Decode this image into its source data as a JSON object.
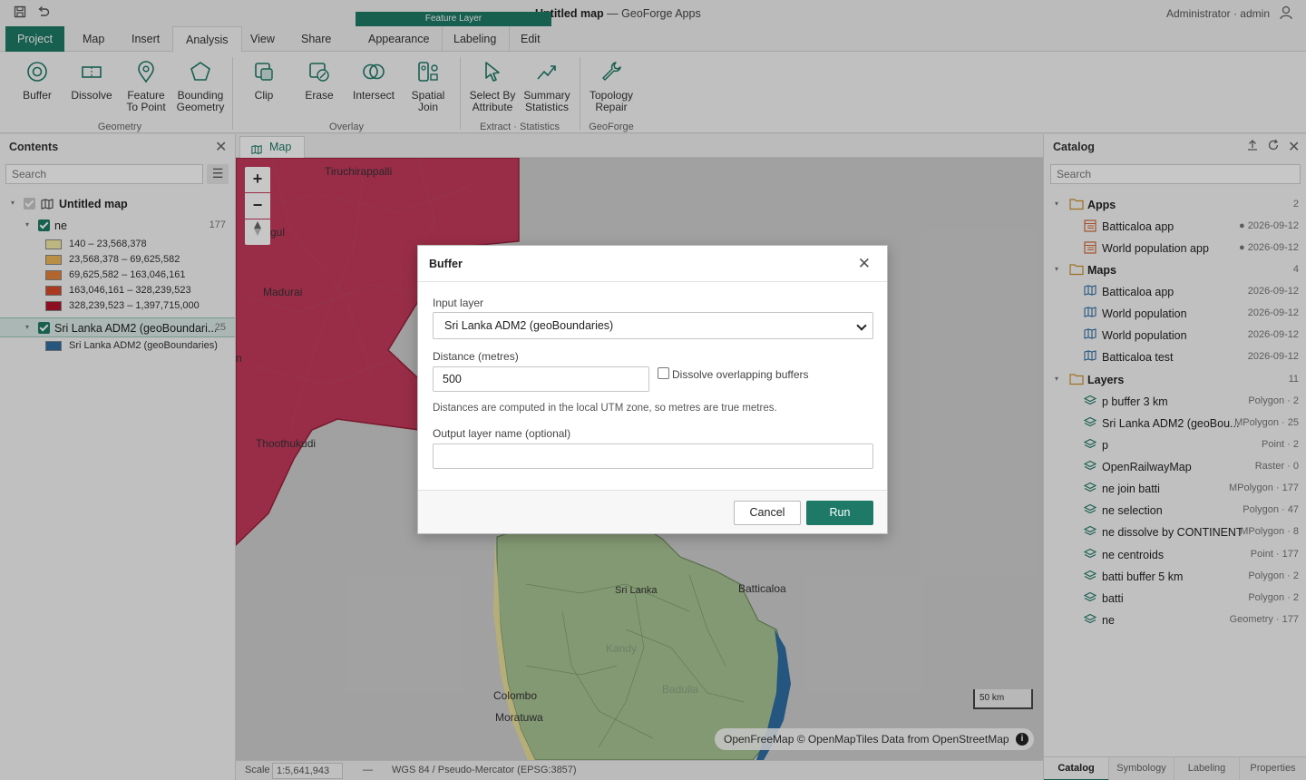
{
  "titlebar": {
    "title_doc": "Untitled map",
    "title_sep": " — ",
    "title_app": "GeoForge Apps",
    "user": "Administrator · admin"
  },
  "tabs": {
    "project": "Project",
    "map": "Map",
    "insert": "Insert",
    "analysis": "Analysis",
    "view": "View",
    "share": "Share",
    "context_label": "Feature Layer",
    "appearance": "Appearance",
    "labeling": "Labeling",
    "edit": "Edit"
  },
  "ribbon": {
    "buttons": [
      {
        "line1": "Buffer",
        "line2": "",
        "icon": "buffer-icon"
      },
      {
        "line1": "Dissolve",
        "line2": "",
        "icon": "dissolve-icon"
      },
      {
        "line1": "Feature",
        "line2": "To Point",
        "icon": "feature-to-point-icon"
      },
      {
        "line1": "Bounding",
        "line2": "Geometry",
        "icon": "bounding-geometry-icon"
      },
      {
        "line1": "Clip",
        "line2": "",
        "icon": "clip-icon"
      },
      {
        "line1": "Erase",
        "line2": "",
        "icon": "erase-icon"
      },
      {
        "line1": "Intersect",
        "line2": "",
        "icon": "intersect-icon"
      },
      {
        "line1": "Spatial",
        "line2": "Join",
        "icon": "spatial-join-icon"
      },
      {
        "line1": "Select By",
        "line2": "Attribute",
        "icon": "select-by-attribute-icon"
      },
      {
        "line1": "Summary",
        "line2": "Statistics",
        "icon": "summary-statistics-icon"
      },
      {
        "line1": "Topology",
        "line2": "Repair",
        "icon": "topology-repair-icon"
      }
    ],
    "groups": [
      "Geometry",
      "Overlay",
      "Extract · Statistics",
      "GeoForge"
    ]
  },
  "contents": {
    "title": "Contents",
    "search_placeholder": "Search",
    "map_name": "Untitled map",
    "layer_ne": {
      "name": "ne",
      "count": "177"
    },
    "legend": [
      {
        "label": "140 – 23,568,378",
        "color": "#f3e9a6"
      },
      {
        "label": "23,568,378 – 69,625,582",
        "color": "#edb659"
      },
      {
        "label": "69,625,582 – 163,046,161",
        "color": "#e6823b"
      },
      {
        "label": "163,046,161 – 328,239,523",
        "color": "#d94a2a"
      },
      {
        "label": "328,239,523 – 1,397,715,000",
        "color": "#b3142a"
      }
    ],
    "layer_sl": {
      "name": "Sri Lanka ADM2 (geoBoundari...",
      "count": "25",
      "legend_label": "Sri Lanka ADM2 (geoBoundaries)",
      "color": "#2f6fa3"
    }
  },
  "map": {
    "tab_label": "Map",
    "labels": {
      "tiruchirappalli": "Tiruchirappalli",
      "gul": "gul",
      "madurai": "Madurai",
      "n": "n",
      "thoothukudi": "Thoothukudi",
      "srilanka": "Sri Lanka",
      "kandy": "Kandy",
      "badulla": "Badulla",
      "batticaloa": "Batticaloa",
      "colombo": "Colombo",
      "moratuwa": "Moratuwa"
    },
    "zoom_in": "+",
    "zoom_out": "−",
    "scalebar": "50 km",
    "attribution": "OpenFreeMap © OpenMapTiles Data from OpenStreetMap",
    "info": "i"
  },
  "status": {
    "scale_label": "Scale",
    "scale_value": "1:5,641,943",
    "dash": "—",
    "crs": "WGS 84 / Pseudo-Mercator (EPSG:3857)"
  },
  "catalog": {
    "title": "Catalog",
    "search_placeholder": "Search",
    "apps": {
      "label": "Apps",
      "count": "2",
      "items": [
        {
          "name": "Batticaloa app",
          "meta": "● 2026-09-12"
        },
        {
          "name": "World population app",
          "meta": "● 2026-09-12"
        }
      ]
    },
    "maps": {
      "label": "Maps",
      "count": "4",
      "items": [
        {
          "name": "Batticaloa app",
          "meta": "2026-09-12"
        },
        {
          "name": "World population",
          "meta": "2026-09-12"
        },
        {
          "name": "World population",
          "meta": "2026-09-12"
        },
        {
          "name": "Batticaloa test",
          "meta": "2026-09-12"
        }
      ]
    },
    "layers": {
      "label": "Layers",
      "count": "11",
      "items": [
        {
          "name": "p buffer 3 km",
          "meta": "Polygon · 2"
        },
        {
          "name": "Sri Lanka ADM2 (geoBou...",
          "meta": "MPolygon · 25"
        },
        {
          "name": "p",
          "meta": "Point · 2"
        },
        {
          "name": "OpenRailwayMap",
          "meta": "Raster · 0"
        },
        {
          "name": "ne join batti",
          "meta": "MPolygon · 177"
        },
        {
          "name": "ne selection",
          "meta": "Polygon · 47"
        },
        {
          "name": "ne dissolve by CONTINENT",
          "meta": "MPolygon · 8"
        },
        {
          "name": "ne centroids",
          "meta": "Point · 177"
        },
        {
          "name": "batti buffer 5 km",
          "meta": "Polygon · 2"
        },
        {
          "name": "batti",
          "meta": "Polygon · 2"
        },
        {
          "name": "ne",
          "meta": "Geometry · 177"
        }
      ]
    },
    "tabs": [
      "Catalog",
      "Symbology",
      "Labeling",
      "Properties"
    ]
  },
  "dialog": {
    "title": "Buffer",
    "input_layer_label": "Input layer",
    "input_layer_value": "Sri Lanka ADM2 (geoBoundaries)",
    "distance_label": "Distance (metres)",
    "distance_value": "500",
    "dissolve_label": "Dissolve overlapping buffers",
    "note": "Distances are computed in the local UTM zone, so metres are true metres.",
    "output_label": "Output layer name (optional)",
    "output_value": "",
    "cancel": "Cancel",
    "run": "Run"
  },
  "colors": {
    "accent": "#1e7a66",
    "india_fill": "#c43a5b",
    "srilanka_fill": "#a8c594",
    "coast_blue": "#2f6fa3"
  }
}
